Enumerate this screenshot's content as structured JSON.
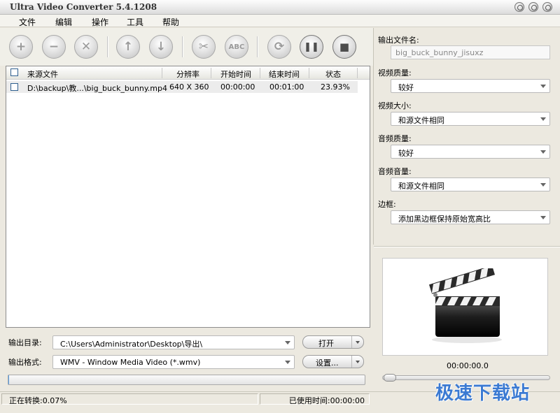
{
  "window": {
    "title": "Ultra Video Converter 5.4.1208"
  },
  "menu": [
    "文件",
    "编辑",
    "操作",
    "工具",
    "帮助"
  ],
  "toolbar": {
    "add": "+",
    "remove": "−",
    "clear": "✕",
    "up": "↑",
    "down": "↓",
    "cut": "✂",
    "rename": "ABC",
    "convert": "⟳",
    "pause": "❚❚",
    "stop": "■"
  },
  "file_list": {
    "headers": [
      "来源文件",
      "分辨率",
      "开始时间",
      "结束时间",
      "状态"
    ],
    "rows": [
      {
        "source": "D:\\backup\\教...\\big_buck_bunny.mp4",
        "resolution": "640 X 360",
        "start": "00:00:00",
        "end": "00:01:00",
        "status": "23.93%"
      }
    ]
  },
  "output": {
    "dir_label": "输出目录:",
    "dir_value": "C:\\Users\\Administrator\\Desktop\\导出\\",
    "open_button": "打开",
    "format_label": "输出格式:",
    "format_value": "WMV - Window Media Video (*.wmv)",
    "settings_button": "设置..."
  },
  "progress": {
    "value": 0.0007
  },
  "status": {
    "left": "正在转换:0.07%",
    "right": "已使用时间:00:00:00"
  },
  "settings": {
    "filename_label": "输出文件名:",
    "filename_value": "big_buck_bunny_jisuxz",
    "video_quality_label": "视频质量:",
    "video_quality_value": "较好",
    "video_size_label": "视频大小:",
    "video_size_value": "和源文件相同",
    "audio_quality_label": "音频质量:",
    "audio_quality_value": "较好",
    "audio_volume_label": "音频音量:",
    "audio_volume_value": "和源文件相同",
    "border_label": "边框:",
    "border_value": "添加黑边框保持原始宽高比"
  },
  "preview": {
    "time": "00:00:00.0"
  },
  "watermark": "极速下载站",
  "icons": [
    "add-icon",
    "remove-icon",
    "clear-icon",
    "up-icon",
    "down-icon",
    "cut-icon",
    "rename-icon",
    "convert-icon",
    "pause-icon",
    "stop-icon",
    "clapperboard-icon"
  ]
}
